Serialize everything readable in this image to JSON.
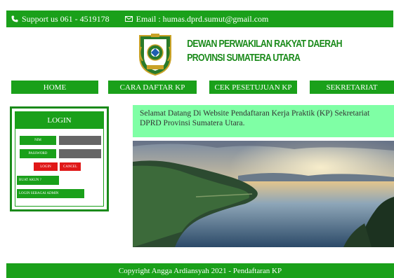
{
  "topbar": {
    "support": "Support us 061 - 4519178",
    "email": "Email : humas.dprd.sumut@gmail.com"
  },
  "header": {
    "title_line1": "DEWAN PERWAKILAN RAKYAT DAERAH",
    "title_line2": "PROVINSI SUMATERA UTARA"
  },
  "nav": {
    "items": [
      "HOME",
      "CARA DAFTAR KP",
      "CEK PESETUJUAN KP",
      "SEKRETARIAT"
    ]
  },
  "login": {
    "heading": "LOGIN",
    "nim_label": "NIM",
    "password_label": "PASSWORD",
    "login_button": "LOGIN",
    "cancel_button": "CANCEL",
    "create_account": "BUAT AKUN ?",
    "admin_login": "LOGIN SEBAGAI ADMIN"
  },
  "welcome": {
    "text": "Selamat Datang Di Website Pendaftaran Kerja Praktik (KP) Sekretariat DPRD Provinsi Sumatera Utara."
  },
  "footer": {
    "text": "Copyright Angga Ardiansyah 2021 - Pendaftaran KP"
  },
  "colors": {
    "green": "#1aa01a",
    "dark_green": "#1a8a1a",
    "welcome_bg": "#7fffa5",
    "red": "#e01818",
    "field_gray": "#666666"
  }
}
